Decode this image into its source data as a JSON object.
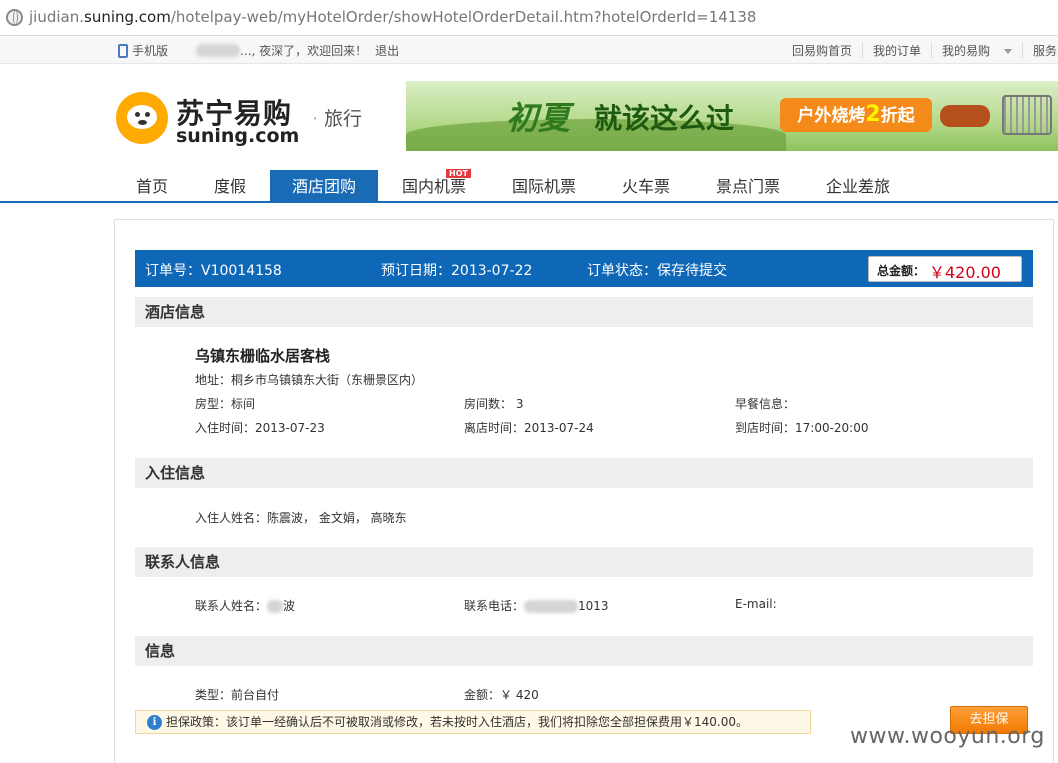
{
  "browser": {
    "url_prefix": "jiudian.",
    "url_domain": "suning.com",
    "url_path": "/hotelpay-web/myHotelOrder/showHotelOrderDetail.htm?hotelOrderId=14138"
  },
  "topbar": {
    "mobile_label": "手机版",
    "welcome_suffix": "..., 夜深了，欢迎回来！",
    "logout_label": "退出",
    "links": [
      "回易购首页",
      "我的订单",
      "我的易购",
      "服务中"
    ]
  },
  "header": {
    "logo_cn": "苏宁易购",
    "logo_en": "suning.com",
    "logo_sub": "旅行",
    "banner_chu": "初夏",
    "banner_slogan": "就该这么过",
    "banner_promo_pre": "户外烧烤",
    "banner_promo_num": "2",
    "banner_promo_post": "折起"
  },
  "nav": {
    "items": [
      "首页",
      "度假",
      "酒店团购",
      "国内机票",
      "国际机票",
      "火车票",
      "景点门票",
      "企业差旅"
    ],
    "hot_badge": "HOT"
  },
  "order": {
    "number_label": "订单号：",
    "number": "V10014158",
    "date_label": "预订日期：",
    "date": "2013-07-22",
    "status_label": "订单状态：",
    "status": "保存待提交",
    "total_label": "总金额：",
    "total": "￥420.00"
  },
  "hotel": {
    "section_title": "酒店信息",
    "name": "乌镇东栅临水居客栈",
    "address": "地址：桐乡市乌镇镇东大街（东栅景区内）",
    "room_type": "房型：标间",
    "room_count": "房间数：  3",
    "breakfast": "早餐信息：",
    "checkin": "入住时间：2013-07-23",
    "checkout": "离店时间：2013-07-24",
    "arrival": "到店时间：17:00-20:00"
  },
  "guests": {
    "section_title": "入住信息",
    "names": "入住人姓名：陈震波， 金文娟， 高晓东"
  },
  "contact": {
    "section_title": "联系人信息",
    "name_label": "联系人姓名：",
    "name_tail": "波",
    "phone_label": "联系电话：",
    "phone_tail": "1013",
    "email_label": "E-mail:"
  },
  "payment": {
    "section_title": "信息",
    "type": "类型：前台自付",
    "amount": "金额：￥ 420"
  },
  "tip": {
    "icon": "i",
    "text": "担保政策：该订单一经确认后不可被取消或修改，若未按时入住酒店，我们将扣除您全部担保费用￥140.00。"
  },
  "guarantee_button": "去担保",
  "watermark": "www.wooyun.org"
}
